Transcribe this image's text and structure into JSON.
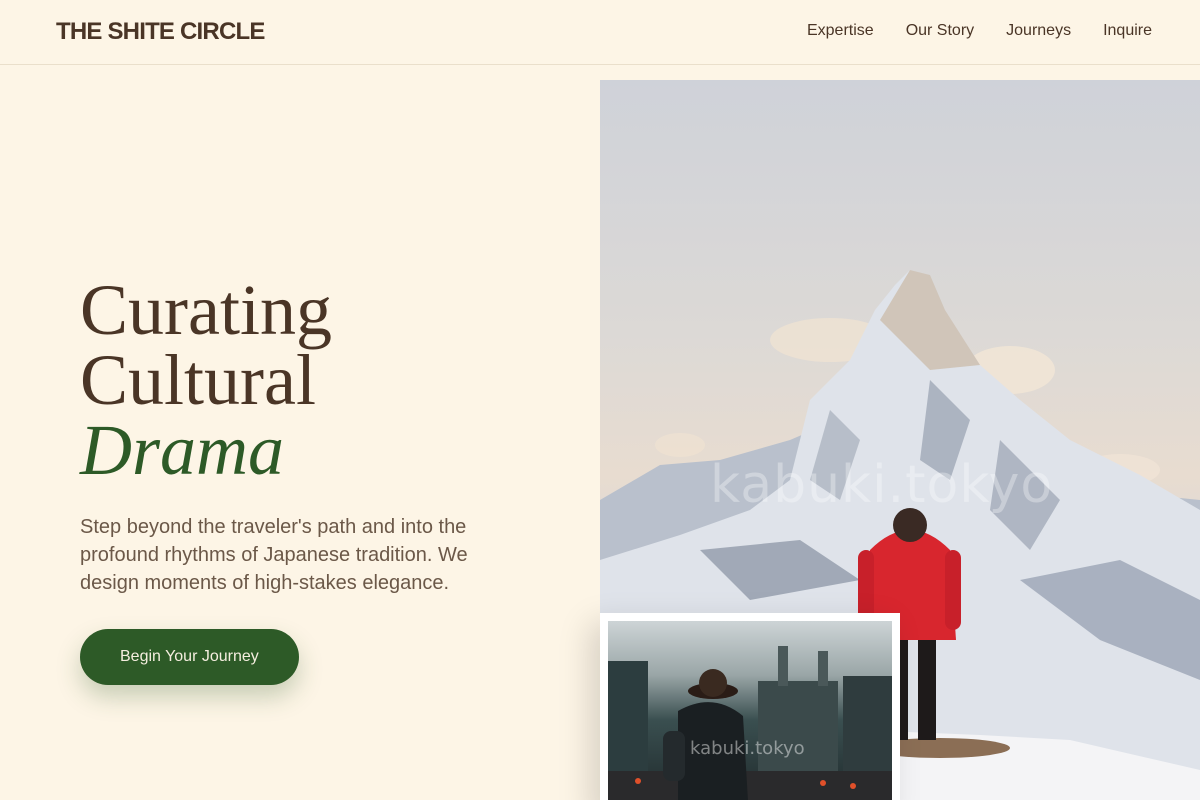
{
  "brand": {
    "name": "THE SHITE CIRCLE"
  },
  "nav": {
    "items": [
      {
        "label": "Expertise"
      },
      {
        "label": "Our Story"
      },
      {
        "label": "Journeys"
      },
      {
        "label": "Inquire"
      }
    ]
  },
  "hero": {
    "line1": "Curating",
    "line2": "Cultural",
    "line3": "Drama",
    "lede": "Step beyond the traveler's path and into the profound rhythms of Japanese tradition. We design moments of high-stakes elegance.",
    "cta_label": "Begin Your Journey"
  },
  "images": {
    "main_watermark": "kabuki.tokyo",
    "inset_watermark": "kabuki.tokyo"
  },
  "colors": {
    "background": "#fdf5e6",
    "text": "#4a3526",
    "accent": "#2d5a27",
    "jacket": "#d8262e"
  }
}
